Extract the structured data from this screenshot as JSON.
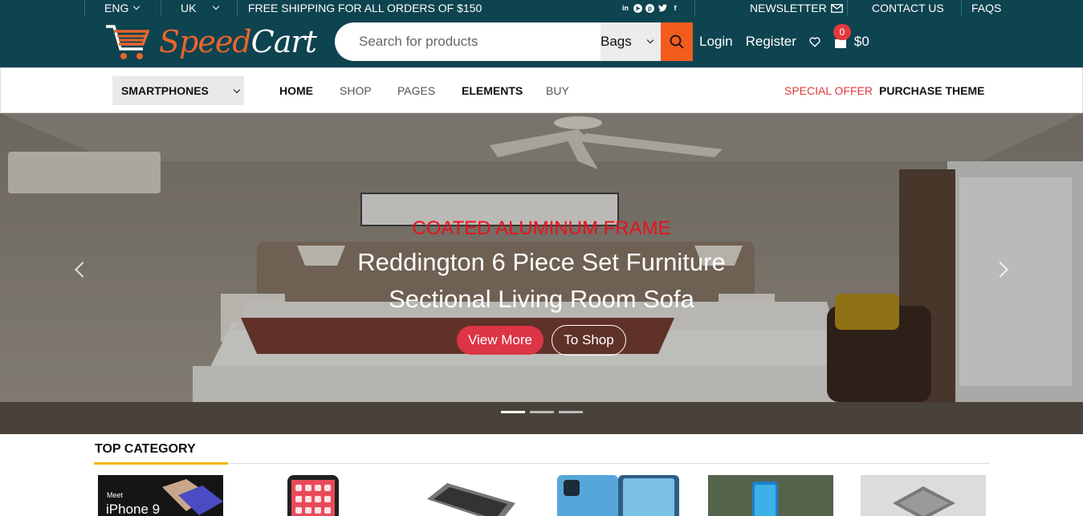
{
  "topbar": {
    "language": "ENG",
    "country": "UK",
    "shipping_notice": "FREE SHIPPING FOR ALL ORDERS OF $150",
    "social_icons": [
      "linkedin-icon",
      "telegram-icon",
      "pinterest-icon",
      "twitter-icon",
      "facebook-icon"
    ],
    "newsletter": "NEWSLETTER",
    "contact": "CONTACT US",
    "faqs": "FAQS"
  },
  "header": {
    "logo_part1": "Speed",
    "logo_part2": "Cart",
    "search_placeholder": "Search for products",
    "search_category": "Bags",
    "login": "Login",
    "register": "Register",
    "cart_count": "0",
    "cart_total": "$0"
  },
  "nav": {
    "category_select": "SMARTPHONES",
    "items": [
      "HOME",
      "SHOP",
      "PAGES",
      "ELEMENTS",
      "BUY"
    ],
    "special_offer": "SPECIAL OFFER",
    "purchase_theme": "PURCHASE THEME"
  },
  "hero": {
    "subtitle": "COATED ALUMINUM FRAME",
    "title_line1": "Reddington 6 Piece Set Furniture",
    "title_line2": "Sectional Living Room Sofa",
    "view_more": "View More",
    "to_shop": "To Shop",
    "active_slide": 1,
    "slide_count": 3
  },
  "top_category": {
    "title": "TOP CATEGORY",
    "card1_caption_small": "Meet",
    "card1_caption_big": "iPhone 9"
  },
  "colors": {
    "brand_dark": "#0e4350",
    "accent_orange": "#f25c1c",
    "accent_red": "#dc3545",
    "special_offer": "#e03a3e",
    "underline_yellow": "#f2b705"
  }
}
